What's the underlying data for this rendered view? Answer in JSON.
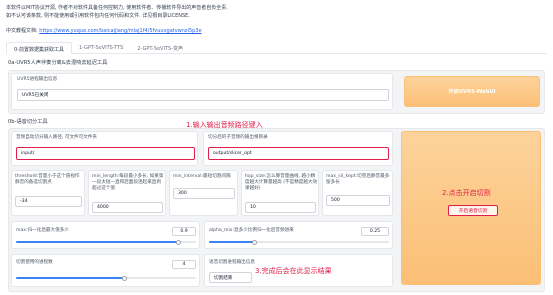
{
  "notice": {
    "line1": "本软件以MIT协议开源, 作者不对软件具备任何控制力, 使用软件者、传播软件导出的声音者自负全责.",
    "line2": "如不认可该条款, 则不能使用或引用软件包内任何代码和文件. 详见根目录LICENSE.",
    "tutorial_prefix": "中文教程文档: ",
    "tutorial_link": "https://www.yuque.com/baicaijiang/mlaj1f4/5fvuuvgatvwnzi5p3e"
  },
  "tabs": [
    {
      "label": "0-前置数据集获取工具"
    },
    {
      "label": "1-GPT-SoVITS-TTS"
    },
    {
      "label": "2-GPT-SoVITS-变声"
    }
  ],
  "uvr5": {
    "section_title": "0a-UVR5人声伴奏分离&去混响去延迟工具",
    "status_label": "UVR5进程输出信息",
    "status_value": "UVR5已关闭",
    "button_label": "开启UVR5-WebUI"
  },
  "slicer": {
    "section_title": "0b-语音切分工具",
    "input_path_label": "音频自动切分输入路径, 可文件可文件夹",
    "input_path_value": "input/",
    "output_dir_label": "切分后的子音频的输出根目录",
    "output_dir_value": "output/slicer_opt",
    "threshold_label": "threshold:音量小于这个值视作静音的备选切割点",
    "threshold_value": "-34",
    "min_length_label": "min_length:每段最小多长, 如果第一段太短一直和后面段连起来直到超过这个值",
    "min_length_value": "4000",
    "min_interval_label": "min_interval:最短切割间隔",
    "min_interval_value": "300",
    "hop_size_label": "hop_size:怎么算音量曲线, 越小精度越大计算量越高 (不是精度越大效果越好)",
    "hop_size_value": "10",
    "max_sil_kept_label": "max_sil_kept:切完后静音最多留多长",
    "max_sil_kept_value": "500",
    "max_label": "max:归一化后最大值多少",
    "max_value": "0.9",
    "max_fraction": 0.9,
    "alpha_label": "alpha_mix:混多少比例归一化后音频进来",
    "alpha_value": "0.25",
    "alpha_fraction": 0.25,
    "n_process_label": "切割使用的进程数",
    "n_process_value": "4",
    "n_process_fraction": 0.6,
    "output_info_label": "语音切割进程输出信息",
    "output_info_value": "切割结束",
    "start_button": "开启语音切割"
  },
  "annotations": {
    "a1": "1.输入输出音频路径键入",
    "a2": "2.点击开启切割",
    "a3": "3.完成后会在此显示结果"
  },
  "colors": {
    "annotation_red": "#e11d48",
    "orange_button": "#fbbf76",
    "slider_blue": "#3b82f6"
  }
}
